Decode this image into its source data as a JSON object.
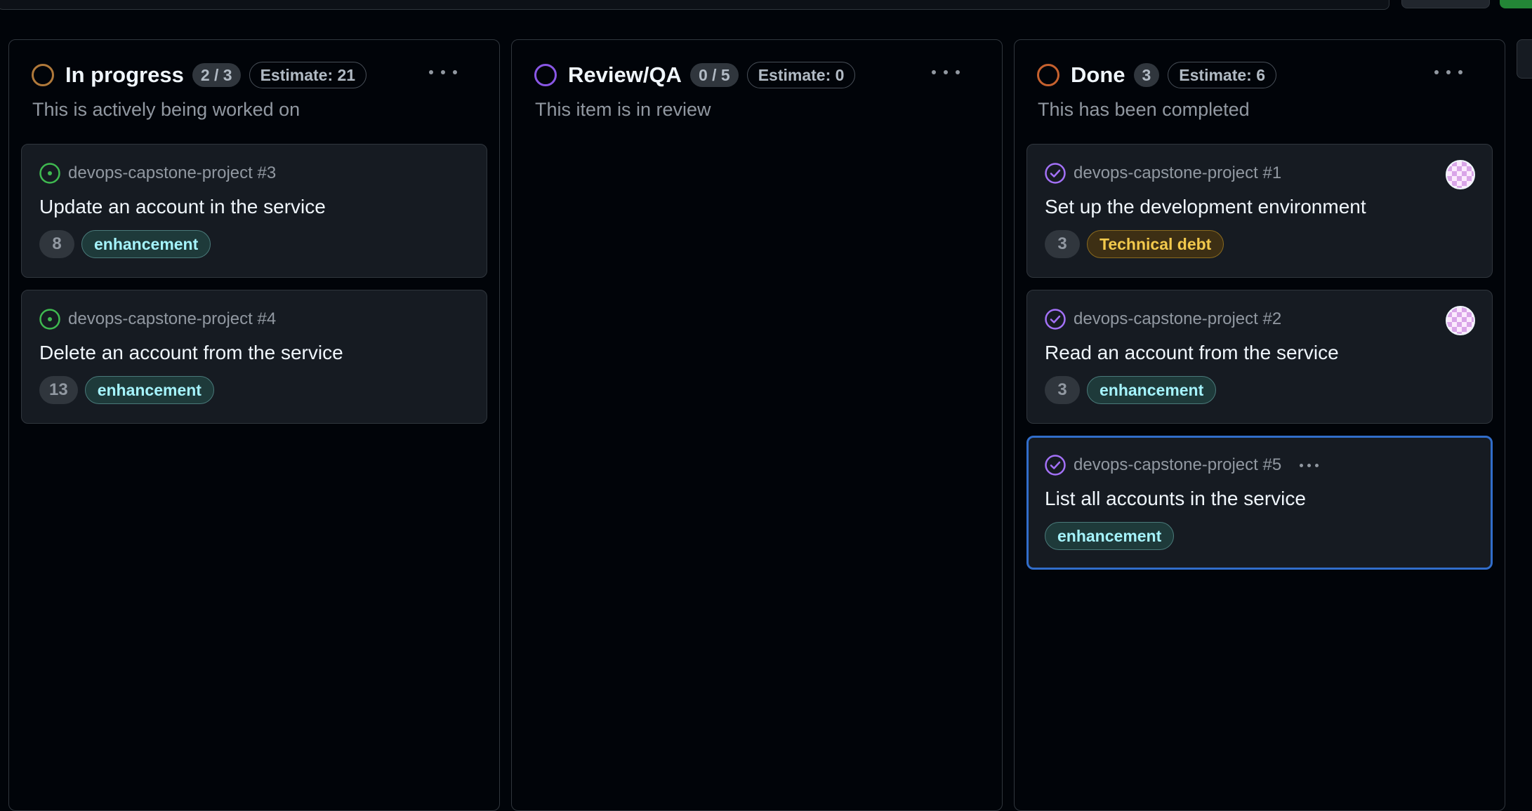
{
  "colors": {
    "in_progress_ring": "#b0793a",
    "review_ring": "#8957e5",
    "done_ring": "#c6612e",
    "open_issue": "#3fb950",
    "closed_issue": "#a371f7",
    "selected_border": "#316dca"
  },
  "columns": [
    {
      "title": "In progress",
      "count": "2 / 3",
      "estimate": "Estimate: 21",
      "description": "This is actively being worked on",
      "cards": [
        {
          "ref": "devops-capstone-project #3",
          "title": "Update an account in the service",
          "points": "8",
          "label": "enhancement",
          "icon": "open-issue-icon"
        },
        {
          "ref": "devops-capstone-project #4",
          "title": "Delete an account from the service",
          "points": "13",
          "label": "enhancement",
          "icon": "open-issue-icon"
        }
      ]
    },
    {
      "title": "Review/QA",
      "count": "0 / 5",
      "estimate": "Estimate: 0",
      "description": "This item is in review",
      "cards": []
    },
    {
      "title": "Done",
      "count": "3",
      "estimate": "Estimate: 6",
      "description": "This has been completed",
      "cards": [
        {
          "ref": "devops-capstone-project #1",
          "title": "Set up the development environment",
          "points": "3",
          "label": "Technical debt",
          "icon": "closed-issue-icon"
        },
        {
          "ref": "devops-capstone-project #2",
          "title": "Read an account from the service",
          "points": "3",
          "label": "enhancement",
          "icon": "closed-issue-icon"
        },
        {
          "ref": "devops-capstone-project #5",
          "title": "List all accounts in the service",
          "label": "enhancement",
          "icon": "closed-issue-icon"
        }
      ]
    }
  ]
}
